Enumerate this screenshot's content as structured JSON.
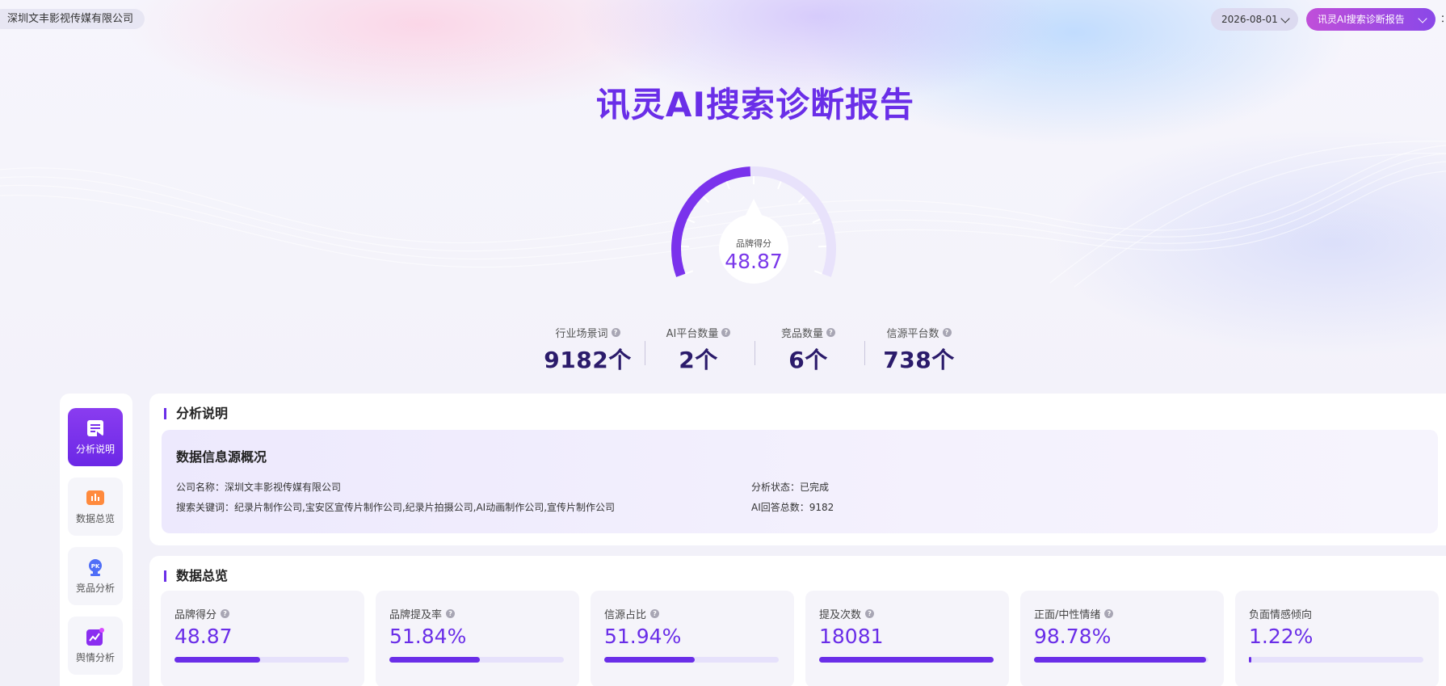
{
  "header": {
    "company": "深圳文丰影视传媒有限公司",
    "date": "2026-08-01",
    "report": "讯灵AI搜索诊断报告",
    "edge_glyph": "："
  },
  "title": "讯灵AI搜索诊断报告",
  "gauge": {
    "label": "品牌得分",
    "value": "48.87",
    "score": 48.87,
    "max": 100
  },
  "stats": [
    {
      "label": "行业场景词",
      "value": "9182个"
    },
    {
      "label": "AI平台数量",
      "value": "2个"
    },
    {
      "label": "竞品数量",
      "value": "6个"
    },
    {
      "label": "信源平台数",
      "value": "738个"
    }
  ],
  "nav": [
    {
      "label": "分析说明",
      "icon": "document-icon",
      "active": true
    },
    {
      "label": "数据总览",
      "icon": "bar-chart-icon",
      "active": false
    },
    {
      "label": "竞品分析",
      "icon": "pk-trophy-icon",
      "active": false
    },
    {
      "label": "舆情分析",
      "icon": "trend-chart-icon",
      "active": false
    }
  ],
  "analysis": {
    "section_title": "分析说明",
    "box_title": "数据信息源概况",
    "company_line": "公司名称：深圳文丰影视传媒有限公司",
    "keywords_line": "搜索关键词：纪录片制作公司,宝安区宣传片制作公司,纪录片拍摄公司,AI动画制作公司,宣传片制作公司",
    "status_line": "分析状态：已完成",
    "answers_line": "AI回答总数：9182"
  },
  "overview": {
    "section_title": "数据总览",
    "cards": [
      {
        "label": "品牌得分",
        "value": "48.87",
        "progress": 0.4887,
        "help": true
      },
      {
        "label": "品牌提及率",
        "value": "51.84%",
        "progress": 0.5184,
        "help": true
      },
      {
        "label": "信源占比",
        "value": "51.94%",
        "progress": 0.5194,
        "help": true
      },
      {
        "label": "提及次数",
        "value": "18081",
        "progress": 1.0,
        "help": true
      },
      {
        "label": "正面/中性情绪",
        "value": "98.78%",
        "progress": 0.9878,
        "help": true
      },
      {
        "label": "负面情感倾向",
        "value": "1.22%",
        "progress": 0.0122,
        "help": false
      }
    ]
  },
  "colors": {
    "accent": "#6a2ee8",
    "accent_light": "#e6e1fb",
    "report_button": "#a84ce0"
  }
}
